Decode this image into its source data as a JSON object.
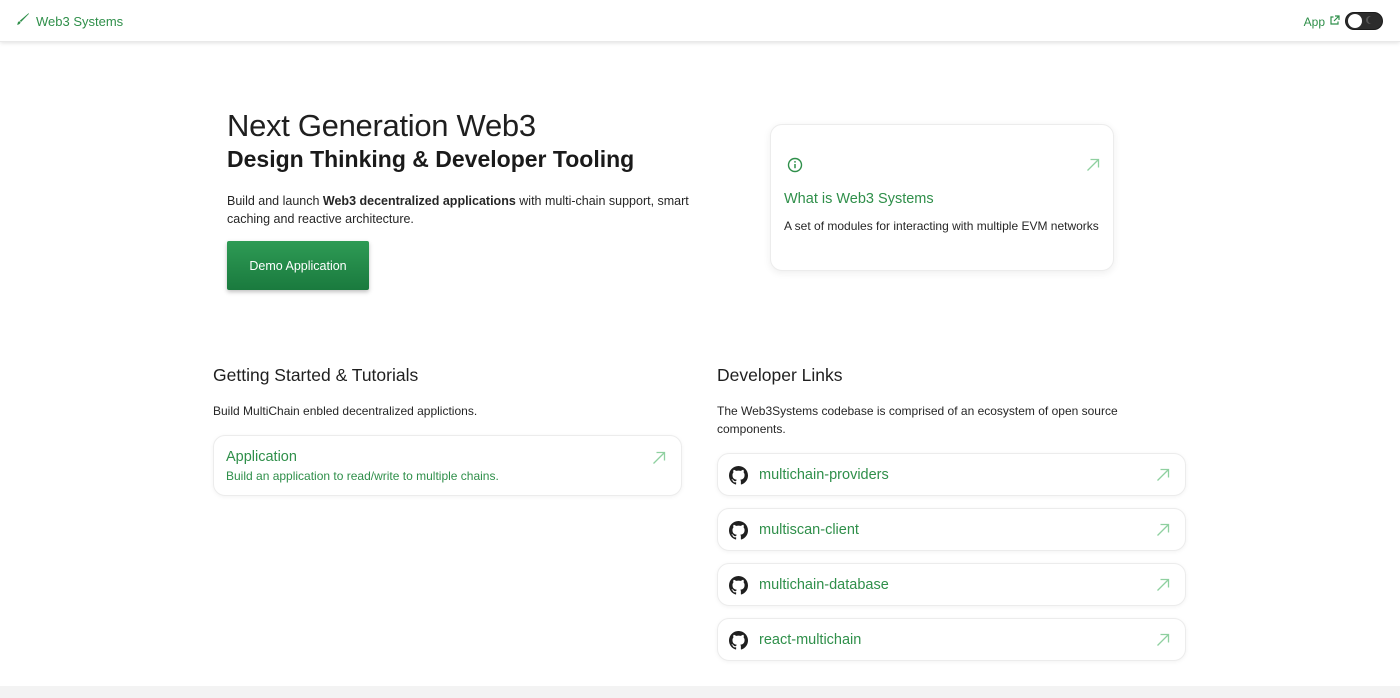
{
  "header": {
    "brand": "Web3 Systems",
    "app_link": "App",
    "theme_toggle": "off"
  },
  "hero": {
    "title": "Next Generation Web3",
    "subtitle": "Design Thinking & Developer Tooling",
    "desc_prefix": "Build and launch ",
    "desc_bold": "Web3 decentralized applications",
    "desc_suffix": " with multi-chain support, smart caching and reactive architecture.",
    "cta": "Demo Application"
  },
  "info_card": {
    "title": "What is Web3 Systems",
    "description": "A set of modules for interacting with multiple EVM networks"
  },
  "getting_started": {
    "title": "Getting Started & Tutorials",
    "description": "Build MultiChain enbled decentralized applictions.",
    "cards": [
      {
        "title": "Application",
        "description": "Build an application to read/write to multiple chains."
      }
    ]
  },
  "developer_links": {
    "title": "Developer Links",
    "description": "The Web3Systems codebase is comprised of an ecosystem of open source components.",
    "items": [
      {
        "label": "multichain-providers"
      },
      {
        "label": "multiscan-client"
      },
      {
        "label": "multichain-database"
      },
      {
        "label": "react-multichain"
      }
    ]
  },
  "colors": {
    "accent": "#2f8f4a",
    "button_top": "#2e9b55",
    "button_bottom": "#1a7a3e"
  }
}
